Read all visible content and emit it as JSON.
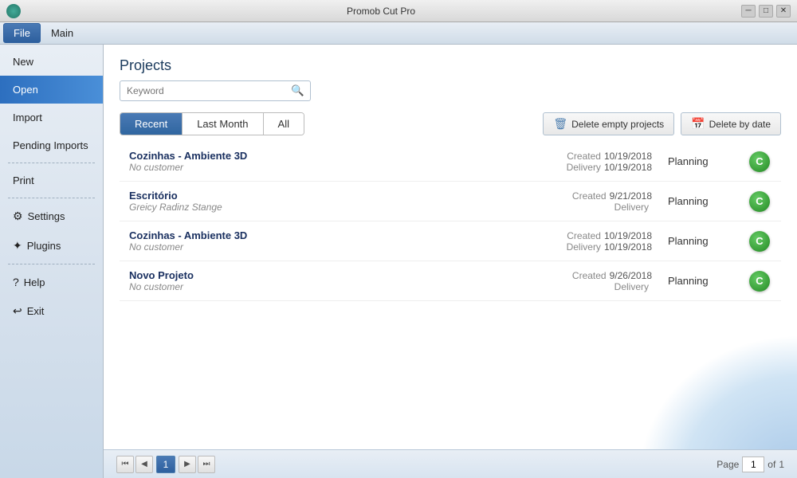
{
  "titlebar": {
    "title": "Promob Cut Pro",
    "minimize": "─",
    "maximize": "□",
    "close": "✕"
  },
  "menubar": {
    "items": [
      {
        "label": "File",
        "active": true
      },
      {
        "label": "Main",
        "active": false
      }
    ]
  },
  "sidebar": {
    "items": [
      {
        "id": "new",
        "label": "New",
        "icon": "",
        "active": false,
        "has_icon": false
      },
      {
        "id": "open",
        "label": "Open",
        "icon": "",
        "active": true,
        "has_icon": false
      },
      {
        "id": "import",
        "label": "Import",
        "icon": "",
        "active": false,
        "has_icon": false
      },
      {
        "id": "pending-imports",
        "label": "Pending Imports",
        "icon": "",
        "active": false,
        "has_icon": false
      },
      {
        "id": "print",
        "label": "Print",
        "icon": "",
        "active": false,
        "has_icon": false
      },
      {
        "id": "settings",
        "label": "Settings",
        "icon": "⚙",
        "active": false,
        "has_icon": true
      },
      {
        "id": "plugins",
        "label": "Plugins",
        "icon": "✦",
        "active": false,
        "has_icon": true
      },
      {
        "id": "help",
        "label": "Help",
        "icon": "?",
        "active": false,
        "has_icon": true
      },
      {
        "id": "exit",
        "label": "Exit",
        "icon": "↩",
        "active": false,
        "has_icon": true
      }
    ]
  },
  "content": {
    "title": "Projects",
    "search": {
      "placeholder": "Keyword",
      "value": ""
    },
    "tabs": [
      {
        "id": "recent",
        "label": "Recent",
        "active": true
      },
      {
        "id": "last-month",
        "label": "Last Month",
        "active": false
      },
      {
        "id": "all",
        "label": "All",
        "active": false
      }
    ],
    "actions": [
      {
        "id": "delete-empty",
        "label": "Delete empty projects",
        "icon": "🗑"
      },
      {
        "id": "delete-date",
        "label": "Delete by date",
        "icon": "📅"
      }
    ],
    "projects": [
      {
        "name": "Cozinhas - Ambiente 3D",
        "customer": "No customer",
        "created_label": "Created",
        "created_date": "10/19/2018",
        "delivery_label": "Delivery",
        "delivery_date": "10/19/2018",
        "status": "Planning",
        "status_icon": "C"
      },
      {
        "name": "Escritório",
        "customer": "Greicy Radinz Stange",
        "created_label": "Created",
        "created_date": "9/21/2018",
        "delivery_label": "Delivery",
        "delivery_date": "",
        "status": "Planning",
        "status_icon": "C"
      },
      {
        "name": "Cozinhas - Ambiente 3D",
        "customer": "No customer",
        "created_label": "Created",
        "created_date": "10/19/2018",
        "delivery_label": "Delivery",
        "delivery_date": "10/19/2018",
        "status": "Planning",
        "status_icon": "C"
      },
      {
        "name": "Novo Projeto",
        "customer": "No customer",
        "created_label": "Created",
        "created_date": "9/26/2018",
        "delivery_label": "Delivery",
        "delivery_date": "",
        "status": "Planning",
        "status_icon": "C"
      }
    ],
    "pagination": {
      "first": "⏮",
      "prev": "◀",
      "current": "1",
      "next": "▶",
      "last": "⏭",
      "page_label": "Page",
      "of_label": "of",
      "total": "1"
    }
  }
}
